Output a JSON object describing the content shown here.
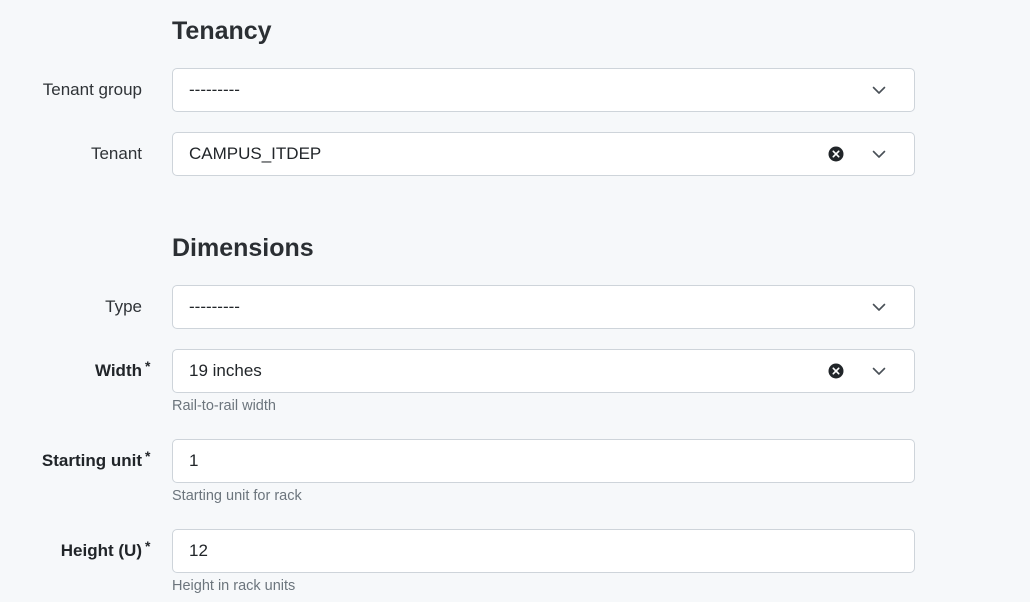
{
  "tenancy": {
    "title": "Tenancy",
    "tenant_group": {
      "label": "Tenant group",
      "value": "---------"
    },
    "tenant": {
      "label": "Tenant",
      "value": "CAMPUS_ITDEP"
    }
  },
  "dimensions": {
    "title": "Dimensions",
    "type": {
      "label": "Type",
      "value": "---------"
    },
    "width": {
      "label": "Width",
      "required_mark": "*",
      "value": "19 inches",
      "help": "Rail-to-rail width"
    },
    "starting_unit": {
      "label": "Starting unit",
      "required_mark": "*",
      "value": "1",
      "help": "Starting unit for rack"
    },
    "height": {
      "label": "Height (U)",
      "required_mark": "*",
      "value": "12",
      "help": "Height in rack units"
    }
  }
}
